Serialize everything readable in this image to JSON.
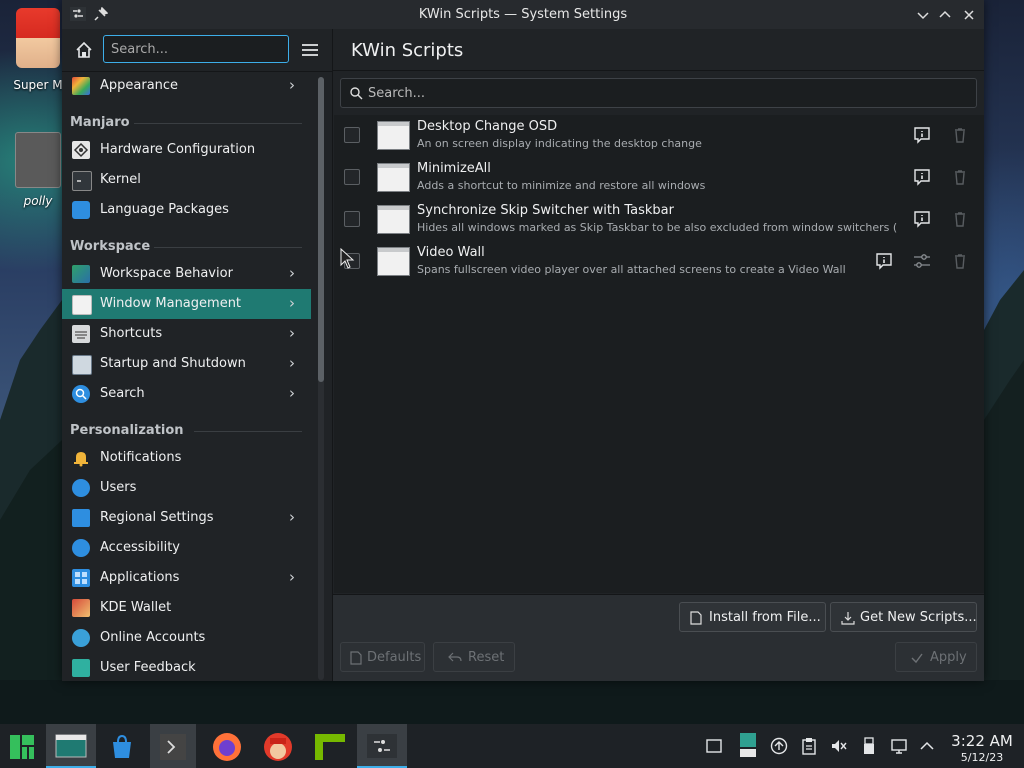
{
  "desktop": {
    "icons": [
      {
        "label": "Super M",
        "icon": "super-mario-icon"
      },
      {
        "label": "polly",
        "icon": "polly-icon"
      }
    ]
  },
  "window": {
    "title": "KWin Scripts — System Settings",
    "controls": [
      "minimize",
      "maximize",
      "close"
    ]
  },
  "sidebar": {
    "search_placeholder": "Search...",
    "top_items": [
      {
        "label": "Appearance",
        "icon": "appearance-icon",
        "has_children": true
      }
    ],
    "categories": [
      {
        "label": "Manjaro",
        "items": [
          {
            "label": "Hardware Configuration",
            "icon": "hardware-icon",
            "has_children": false
          },
          {
            "label": "Kernel",
            "icon": "kernel-icon",
            "has_children": false
          },
          {
            "label": "Language Packages",
            "icon": "language-icon",
            "has_children": false
          }
        ]
      },
      {
        "label": "Workspace",
        "items": [
          {
            "label": "Workspace Behavior",
            "icon": "workspace-behavior-icon",
            "has_children": true
          },
          {
            "label": "Window Management",
            "icon": "window-management-icon",
            "has_children": true,
            "selected": true
          },
          {
            "label": "Shortcuts",
            "icon": "keyboard-icon",
            "has_children": true
          },
          {
            "label": "Startup and Shutdown",
            "icon": "startup-icon",
            "has_children": true
          },
          {
            "label": "Search",
            "icon": "search-icon",
            "has_children": true
          }
        ]
      },
      {
        "label": "Personalization",
        "items": [
          {
            "label": "Notifications",
            "icon": "bell-icon",
            "has_children": false
          },
          {
            "label": "Users",
            "icon": "users-icon",
            "has_children": false
          },
          {
            "label": "Regional Settings",
            "icon": "regional-icon",
            "has_children": true
          },
          {
            "label": "Accessibility",
            "icon": "accessibility-icon",
            "has_children": false
          },
          {
            "label": "Applications",
            "icon": "applications-icon",
            "has_children": true
          },
          {
            "label": "KDE Wallet",
            "icon": "wallet-icon",
            "has_children": false
          },
          {
            "label": "Online Accounts",
            "icon": "online-accounts-icon",
            "has_children": false
          },
          {
            "label": "User Feedback",
            "icon": "feedback-icon",
            "has_children": false
          }
        ]
      }
    ]
  },
  "main": {
    "title": "KWin Scripts",
    "search_placeholder": "Search...",
    "scripts": [
      {
        "name": "Desktop Change OSD",
        "description": "An on screen display indicating the desktop change",
        "enabled": false,
        "configurable": false
      },
      {
        "name": "MinimizeAll",
        "description": "Adds a shortcut to minimize and restore all windows",
        "enabled": false,
        "configurable": false
      },
      {
        "name": "Synchronize Skip Switcher with Taskbar",
        "description": "Hides all windows marked as Skip Taskbar to be also excluded from window switchers (e.g. ...",
        "enabled": false,
        "configurable": false
      },
      {
        "name": "Video Wall",
        "description": "Spans fullscreen video player over all attached screens to create a Video Wall",
        "enabled": false,
        "configurable": true
      }
    ],
    "buttons": {
      "install_from_file": "Install from File...",
      "get_new_scripts": "Get New Scripts...",
      "defaults": "Defaults",
      "reset": "Reset",
      "apply": "Apply"
    }
  },
  "taskbar": {
    "apps": [
      "manjaro-menu-icon",
      "system-settings-icon",
      "discover-icon",
      "konsole-icon",
      "firefox-icon",
      "super-mario-icon",
      "nvidia-icon",
      "terminal-icon"
    ],
    "tray": [
      "show-desktop-icon",
      "notes-icon",
      "updates-icon",
      "clipboard-icon",
      "volume-muted-icon",
      "usb-icon",
      "display-icon",
      "expand-tray-icon"
    ],
    "time": "3:22 AM",
    "date": "5/12/23"
  },
  "colors": {
    "accent": "#3daee9",
    "selection": "#1f7a72",
    "window_bg": "#202326"
  }
}
